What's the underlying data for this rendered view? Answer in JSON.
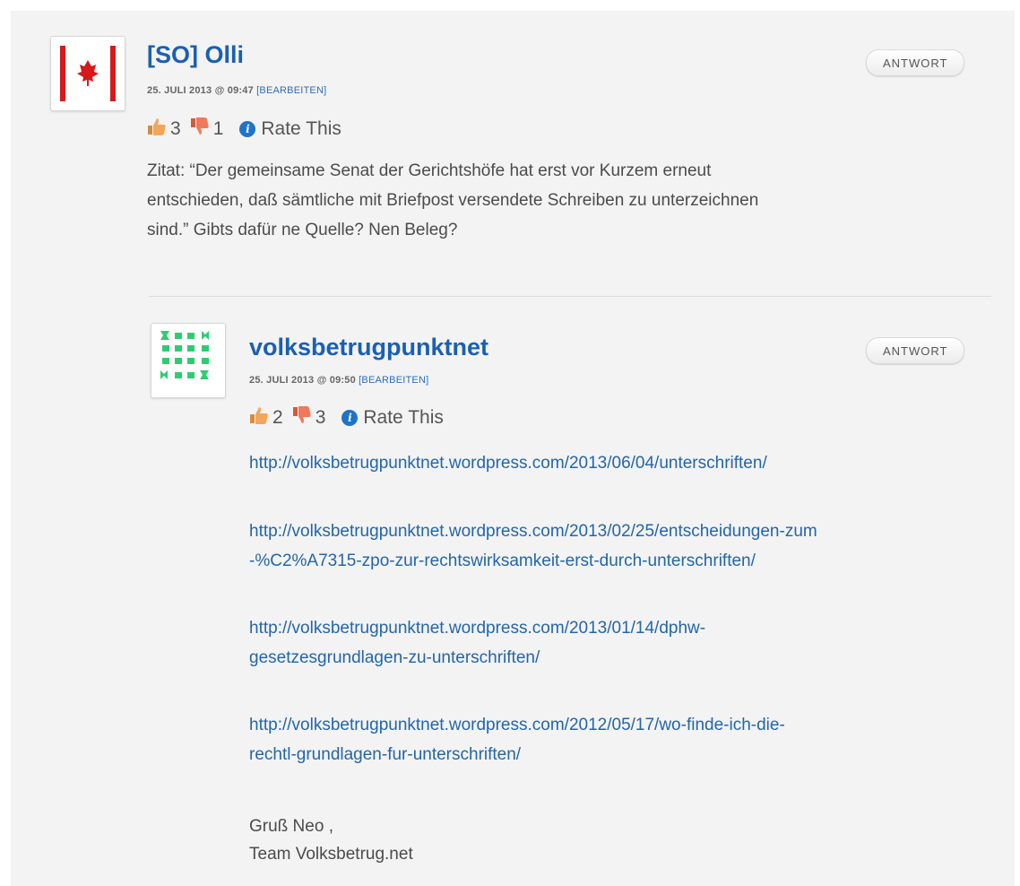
{
  "comments": [
    {
      "author": "[SO] Olli",
      "date": "25. JULI 2013 @ 09:47",
      "edit_label": "[BEARBEITEN]",
      "likes": "3",
      "dislikes": "1",
      "rate_label": "Rate This",
      "reply_label": "ANTWORT",
      "avatar_icon": "red-maple-flag-icon",
      "body_lines": [
        "Zitat: “Der gemeinsame Senat der Gerichtshöfe hat erst vor Kurzem erneut",
        "entschieden, daß sämtliche mit Briefpost versendete Schreiben zu unterzeichnen",
        "sind.” Gibts dafür ne Quelle? Nen Beleg?"
      ]
    },
    {
      "author": "volksbetrugpunktnet",
      "date": "25. JULI 2013 @ 09:50",
      "edit_label": "[BEARBEITEN]",
      "likes": "2",
      "dislikes": "3",
      "rate_label": "Rate This",
      "reply_label": "ANTWORT",
      "avatar_icon": "green-identicon-icon",
      "links": [
        [
          "http://volksbetrugpunktnet.wordpress.com/2013/06/04/unterschriften/"
        ],
        [
          "http://volksbetrugpunktnet.wordpress.com/2013/02/25/entscheidungen-zum",
          "-%C2%A7315-zpo-zur-rechtswirksamkeit-erst-durch-unterschriften/"
        ],
        [
          "http://volksbetrugpunktnet.wordpress.com/2013/01/14/dphw-",
          "gesetzesgrundlagen-zu-unterschriften/"
        ],
        [
          "http://volksbetrugpunktnet.wordpress.com/2012/05/17/wo-finde-ich-die-",
          "rechtl-grundlagen-fur-unterschriften/"
        ]
      ],
      "signoff": [
        "Gruß Neo ,",
        "Team Volksbetrug.net"
      ]
    }
  ],
  "colors": {
    "author_link": "#1a5fb4",
    "url_link": "#2366a8",
    "flag_red": "#d7191c",
    "identicon_green": "#2ecc71",
    "info_blue": "#1f74c6"
  },
  "icons": [
    "thumbs-up-icon",
    "thumbs-down-icon",
    "info-icon"
  ]
}
